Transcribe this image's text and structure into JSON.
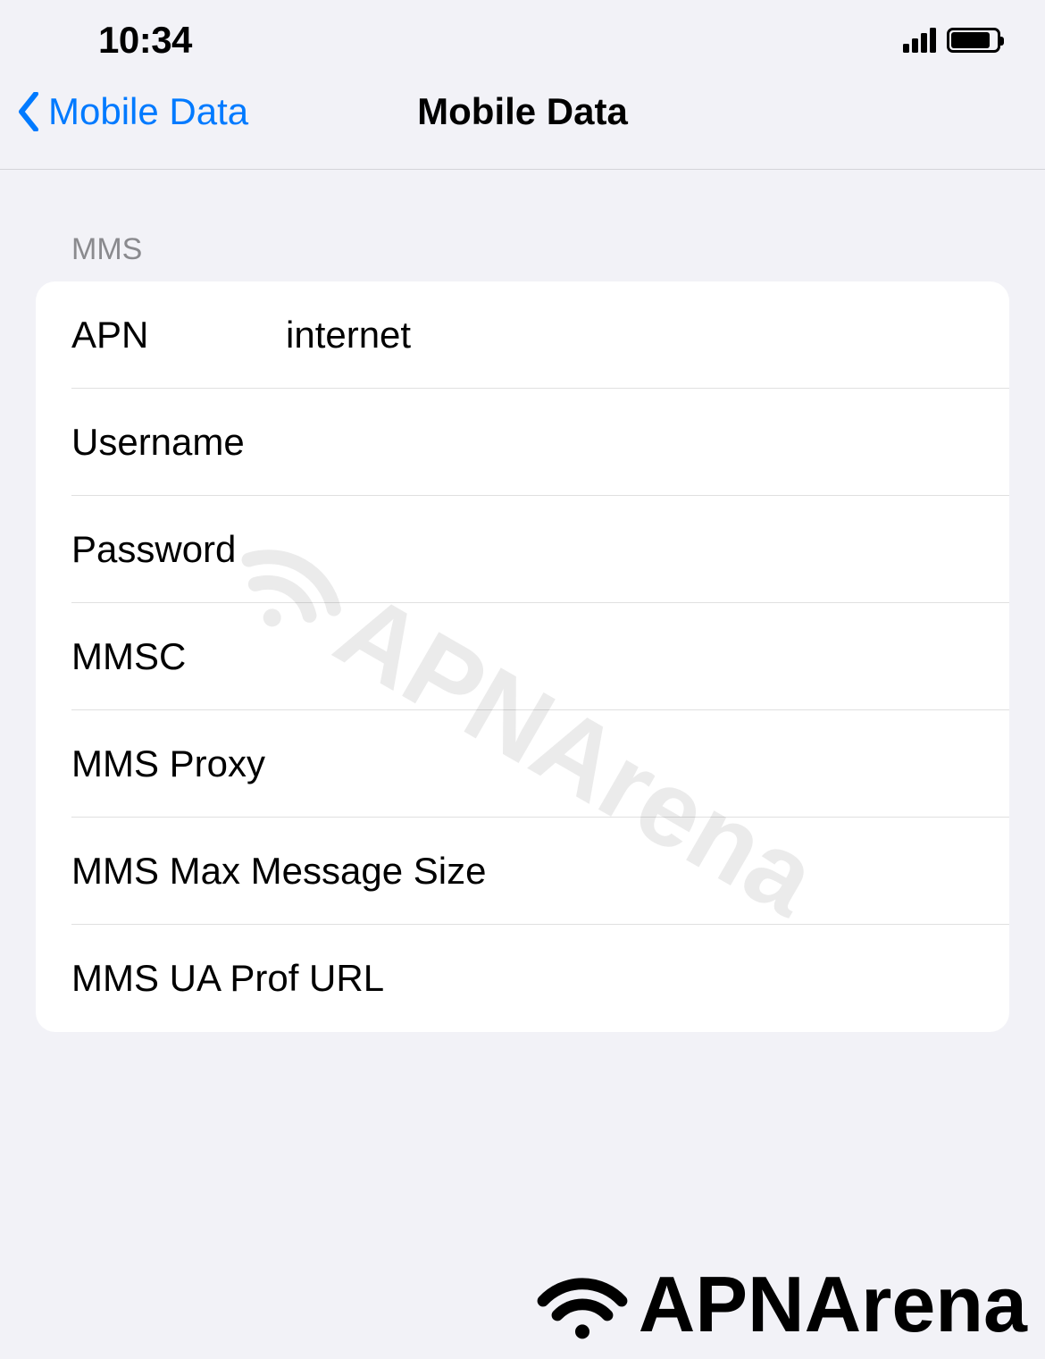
{
  "status_bar": {
    "time": "10:34"
  },
  "nav": {
    "back_label": "Mobile Data",
    "title": "Mobile Data"
  },
  "section": {
    "header": "MMS",
    "rows": [
      {
        "label": "APN",
        "value": "internet"
      },
      {
        "label": "Username",
        "value": ""
      },
      {
        "label": "Password",
        "value": ""
      },
      {
        "label": "MMSC",
        "value": ""
      },
      {
        "label": "MMS Proxy",
        "value": ""
      },
      {
        "label": "MMS Max Message Size",
        "value": ""
      },
      {
        "label": "MMS UA Prof URL",
        "value": ""
      }
    ]
  },
  "watermark": {
    "text": "APNArena"
  }
}
